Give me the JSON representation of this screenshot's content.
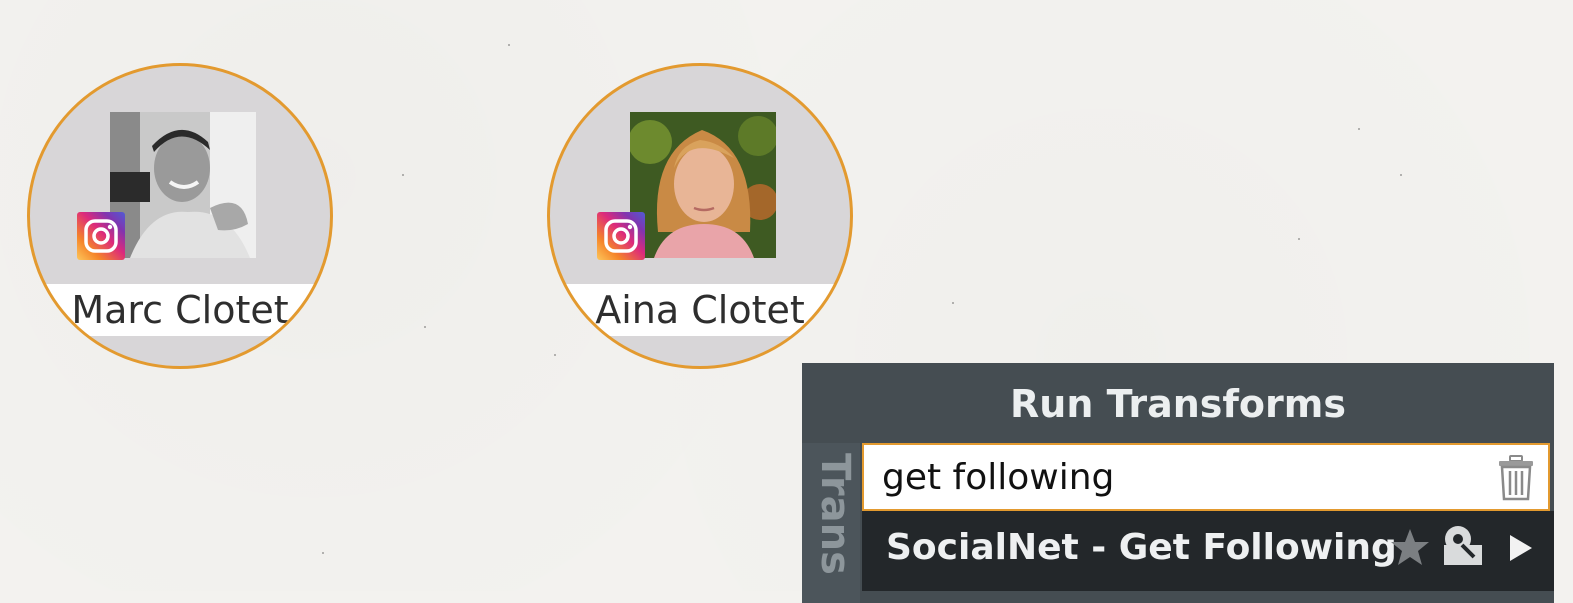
{
  "graph": {
    "nodes": [
      {
        "label": "Marc Clotet",
        "badge": "instagram-icon",
        "photo": "marc-clotet-photo"
      },
      {
        "label": "Aina Clotet",
        "badge": "instagram-icon",
        "photo": "aina-clotet-photo"
      }
    ]
  },
  "run_transforms": {
    "title": "Run Transforms",
    "side_tab": "Trans",
    "search": {
      "value": "get following",
      "clear_icon": "trash-icon"
    },
    "results": [
      {
        "label": "SocialNet - Get Following",
        "icons": [
          "star-icon",
          "settings-icon",
          "run-icon"
        ]
      }
    ]
  },
  "colors": {
    "canvas_background": "#f3f2ef",
    "node_border": "#e39a2f",
    "node_fill": "#d8d6d8",
    "panel_background": "#454d52",
    "result_row_background": "#23272a",
    "search_border": "#e39a2f"
  }
}
